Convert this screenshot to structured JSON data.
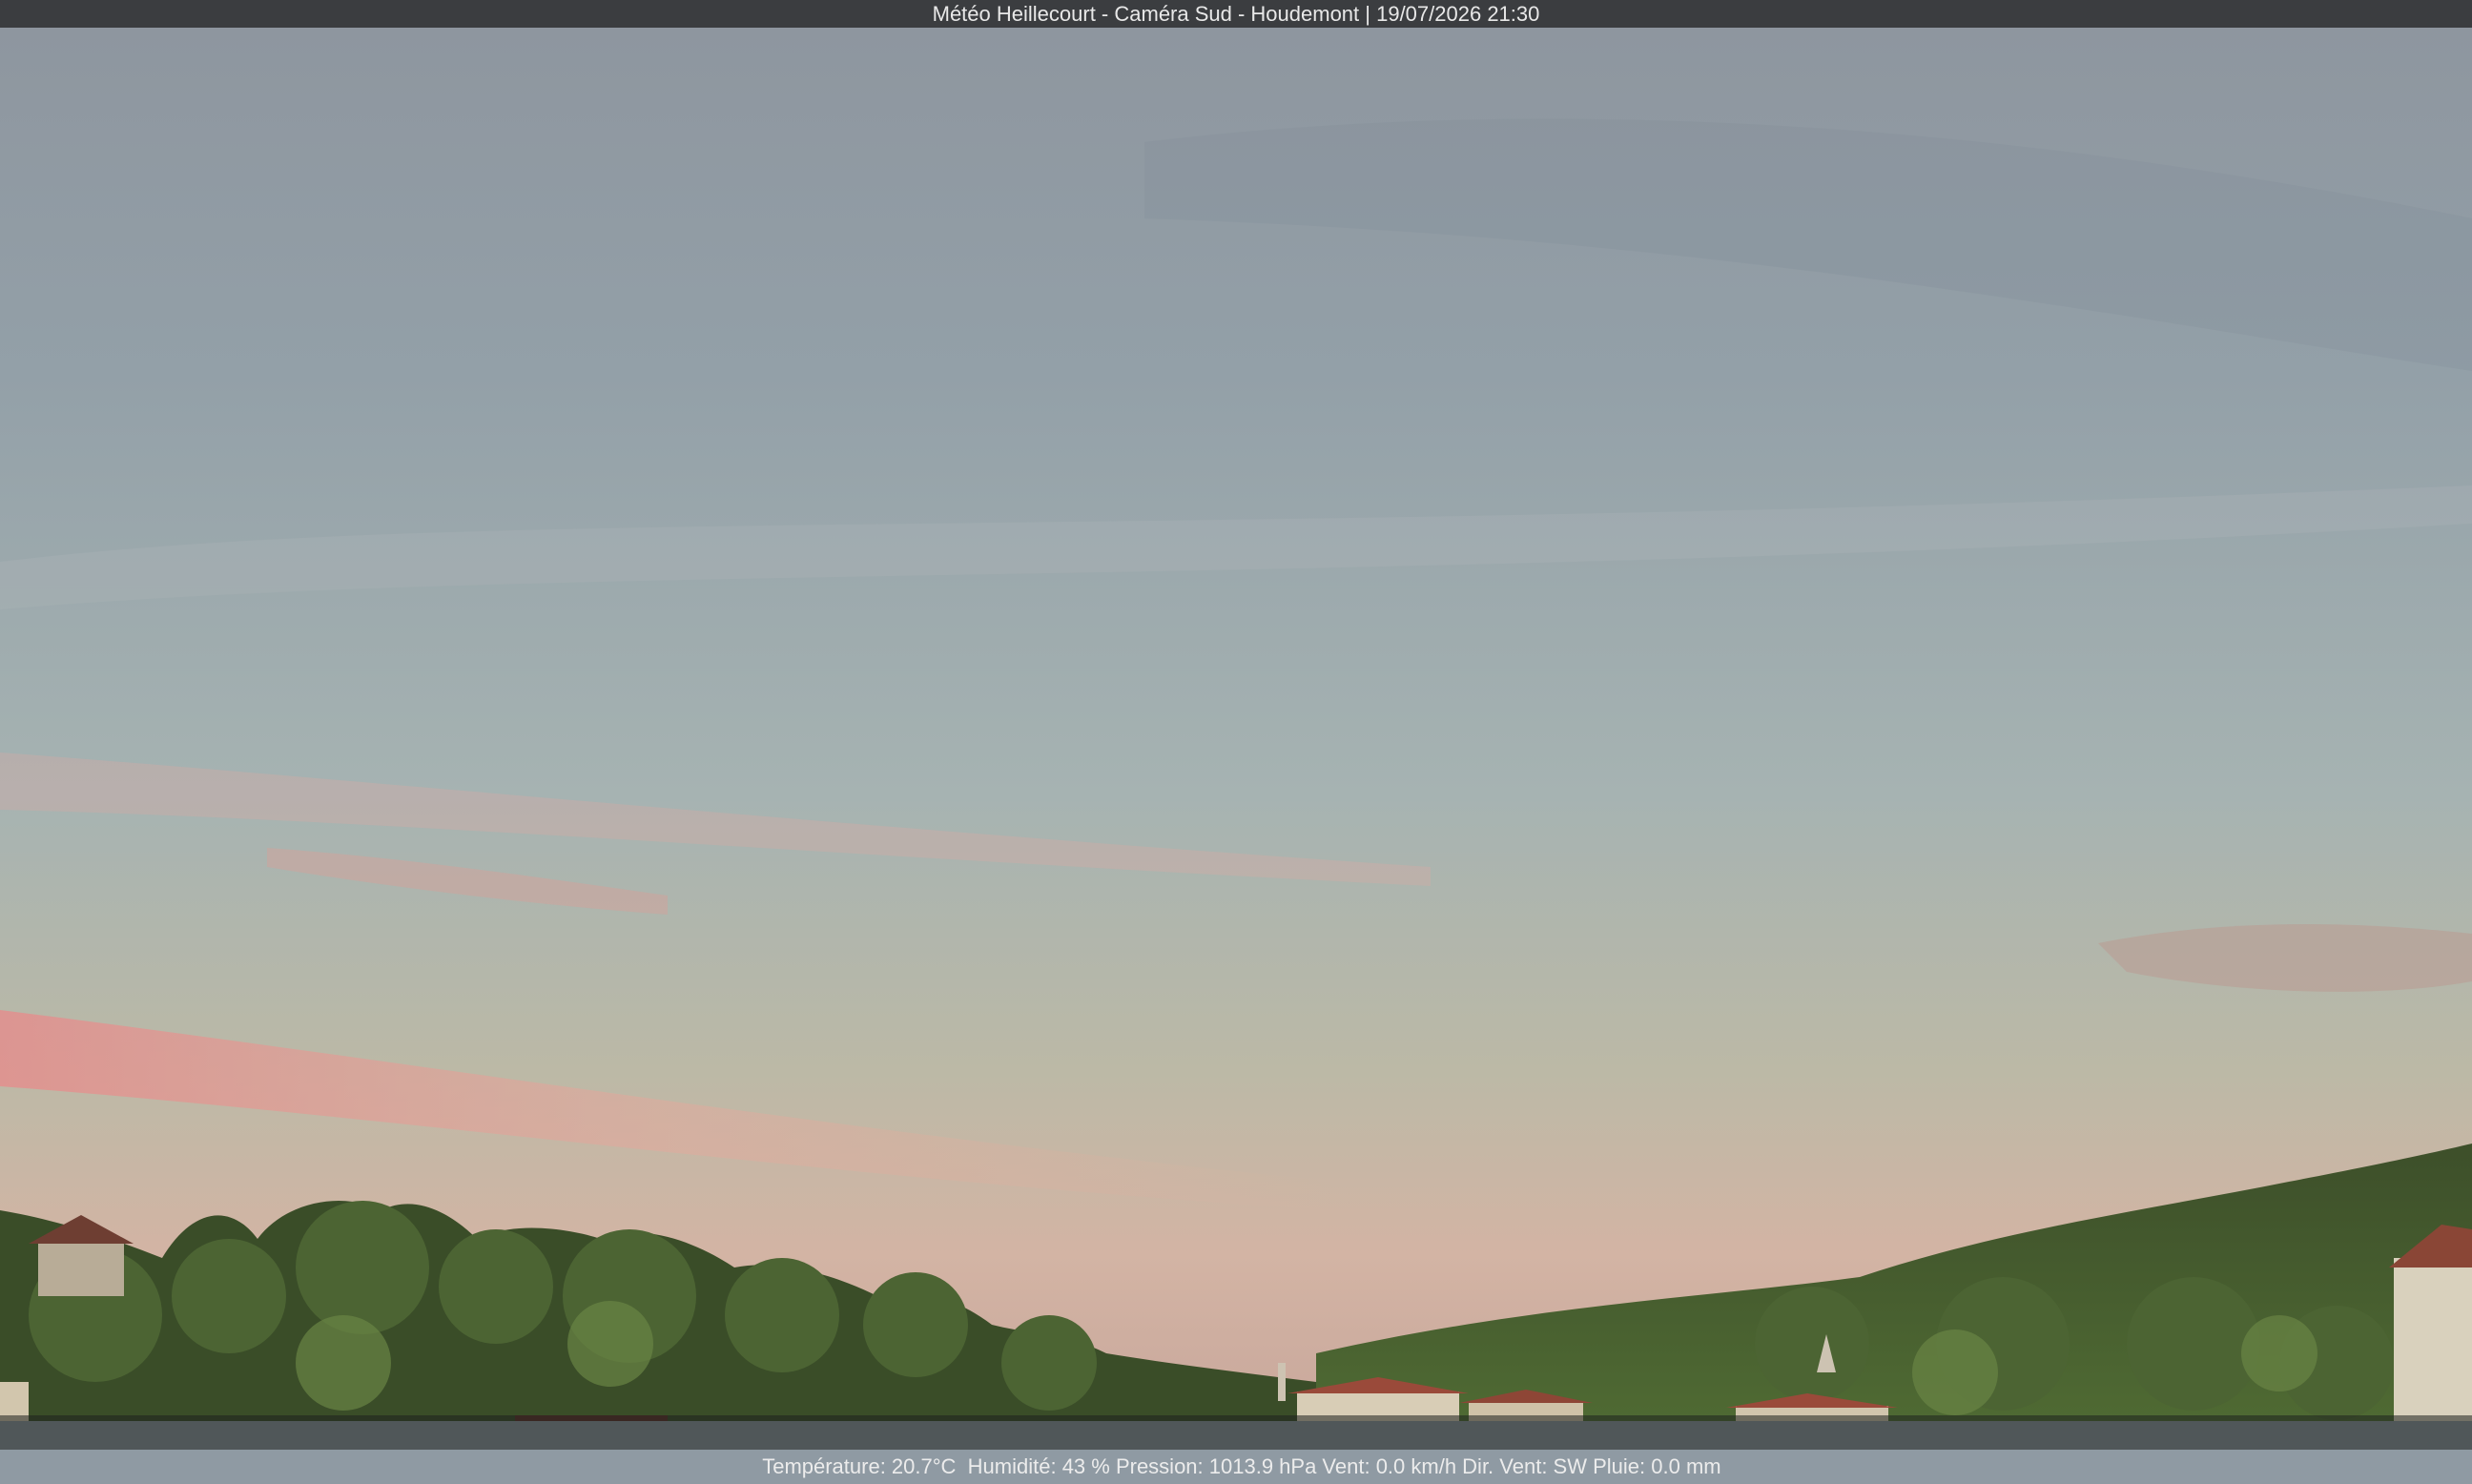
{
  "overlay": {
    "title": "Météo Heillecourt - Caméra Sud - Houdemont | 19/07/2026 21:30",
    "weather": "Température: 20.7°C  Humidité: 43 % Pression: 1013.9 hPa Vent: 0.0 km/h Dir. Vent: SW Pluie: 0.0 mm"
  },
  "colors": {
    "sky_top": "#8e969f",
    "sky_mid": "#a3b0b4",
    "sky_low": "#c0bba6",
    "horizon_pink": "#e6a59b",
    "trees_dark": "#2f3f22",
    "trees_light": "#5f7a3e",
    "roof": "#9a4a3a"
  }
}
